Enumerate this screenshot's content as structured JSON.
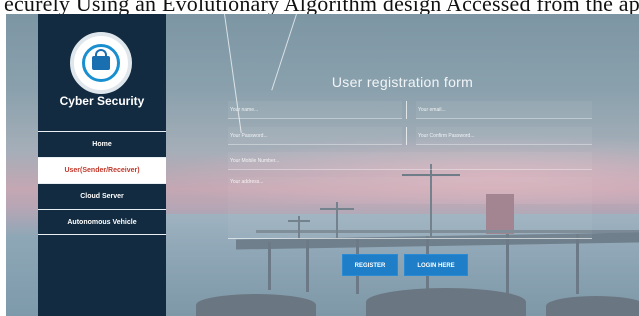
{
  "caption": {
    "text": "ecurely Using an Evolutionary Algorithm design Accessed from the application"
  },
  "sidebar": {
    "brand": "Cyber Security",
    "nav": [
      {
        "label": "Home"
      },
      {
        "label": "User(Sender/Receiver)",
        "active": true
      },
      {
        "label": "Cloud Server"
      },
      {
        "label": "Autonomous Vehicle"
      }
    ]
  },
  "form": {
    "title": "User registration form",
    "name_placeholder": "Your name...",
    "email_placeholder": "Your email...",
    "password_placeholder": "Your Password...",
    "confirm_password_placeholder": "Your Confirm Password...",
    "mobile_placeholder": "Your Mobile Number...",
    "address_placeholder": "Your address...",
    "register_label": "REGISTER",
    "login_label": "LOGIN HERE"
  },
  "colors": {
    "sidebar_bg": "#122b40",
    "active_nav_text": "#c0392b",
    "button_bg": "#1f7ec8"
  },
  "icons": {
    "logo": "cyber-security-lock-icon"
  }
}
